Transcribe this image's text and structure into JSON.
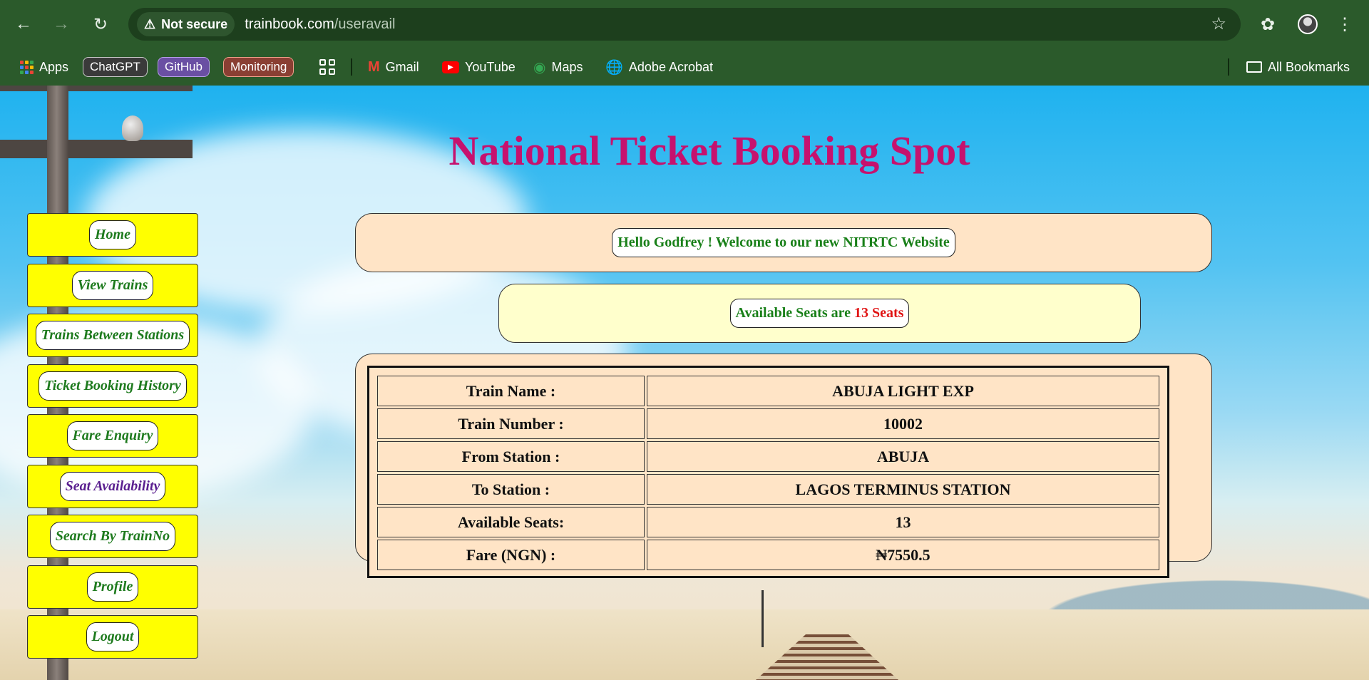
{
  "browser": {
    "security_label": "Not secure",
    "url_host": "trainbook.com",
    "url_path": "/useravail",
    "bookmarks": {
      "apps": "Apps",
      "chatgpt": "ChatGPT",
      "github": "GitHub",
      "monitoring": "Monitoring",
      "gmail": "Gmail",
      "youtube": "YouTube",
      "maps": "Maps",
      "acrobat": "Adobe Acrobat",
      "all_bookmarks": "All Bookmarks"
    }
  },
  "page": {
    "title": "National Ticket Booking Spot",
    "welcome": "Hello Godfrey ! Welcome to our new NITRTC Website",
    "availability": {
      "prefix": "Available Seats are",
      "seats": "13 Seats"
    }
  },
  "sidebar": {
    "items": [
      {
        "label": "Home"
      },
      {
        "label": "View Trains"
      },
      {
        "label": "Trains Between Stations"
      },
      {
        "label": "Ticket Booking History"
      },
      {
        "label": "Fare Enquiry"
      },
      {
        "label": "Seat Availability",
        "active": true
      },
      {
        "label": "Search By TrainNo"
      },
      {
        "label": "Profile"
      },
      {
        "label": "Logout"
      }
    ]
  },
  "train_details": {
    "rows": [
      {
        "label": "Train Name :",
        "value": "ABUJA LIGHT EXP"
      },
      {
        "label": "Train Number :",
        "value": "10002"
      },
      {
        "label": "From Station :",
        "value": "ABUJA"
      },
      {
        "label": "To Station :",
        "value": "LAGOS TERMINUS STATION"
      },
      {
        "label": "Available Seats:",
        "value": "13"
      },
      {
        "label": "Fare (NGN) :",
        "value": "₦7550.5"
      }
    ]
  },
  "colors": {
    "chrome": "#2b5a2b",
    "title": "#c6126e",
    "nav_bg": "#ffff00",
    "nav_text": "#1d7a1d",
    "nav_active": "#5a1f8f",
    "panel_peach": "#ffe4c6",
    "panel_cream": "#ffffcc",
    "seats_red": "#e01414"
  }
}
